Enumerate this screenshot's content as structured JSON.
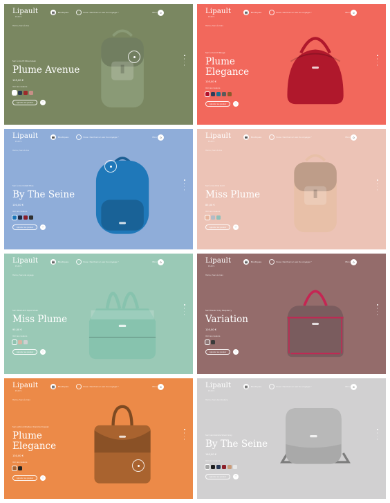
{
  "header": {
    "logo": "Lipault",
    "logo_sub": "PARIS",
    "nav_label": "Boutiques",
    "search_placeholder": "Vous cherchez un sac de voyage ?",
    "account_label": "Mon Sac",
    "cart_count": "0"
  },
  "cards": [
    {
      "bg": "#7a8761",
      "crumb": "Home  /  Sacs à dos",
      "eyebrow": "Sac à dos M Olive Green",
      "name_lines": [
        "Plume Avenue"
      ],
      "price": "105,00 €",
      "colors_label": "Voir les couleurs",
      "swatches": [
        "#ffffff",
        "#2b3b52",
        "#9c2a2b",
        "#c78f86"
      ],
      "cta": "Ajouter au panier",
      "cta_icon": "♡"
    },
    {
      "bg": "#f2685c",
      "crumb": "Home  /  Sacs à main",
      "eyebrow": "Sac à main M Rouge",
      "name_lines": [
        "Plume",
        "Elegance"
      ],
      "price": "105,00 €",
      "colors_label": "Voir les couleurs",
      "swatches": [
        "#b3102b",
        "#2f3d59",
        "#1f6f8f",
        "#5a5a5a",
        "#8b5a2b"
      ],
      "cta": "Ajouter au panier",
      "cta_icon": "♡"
    },
    {
      "bg": "#8fadd9",
      "crumb": "Home  /  Sacs à dos",
      "eyebrow": "Sac à dos Cobalt Blue",
      "name_lines": [
        "By The Seine"
      ],
      "price": "100,00 €",
      "colors_label": "Voir les couleurs",
      "swatches": [
        "#1c74b8",
        "#1f2a44",
        "#8a1e2a",
        "#303030"
      ],
      "cta": "Ajouter au panier",
      "cta_icon": "♡"
    },
    {
      "bg": "#ecc3b6",
      "crumb": "Home  /  Sacs à dos",
      "eyebrow": "Sac à dos Pink Gold",
      "name_lines": [
        "Miss Plume"
      ],
      "price": "85,00 €",
      "colors_label": "Voir les couleurs",
      "swatches": [
        "#e7b59d",
        "#b4bcc6",
        "#8fc0ba"
      ],
      "cta": "Ajouter au panier",
      "cta_icon": "♡"
    },
    {
      "bg": "#9ac9b6",
      "crumb": "Home  /  Sacs de voyage",
      "eyebrow": "Sac Week-end Aqua Green",
      "name_lines": [
        "Miss Plume"
      ],
      "price": "95,00 €",
      "colors_label": "Voir les couleurs",
      "swatches": [
        "#8fc3b0",
        "#d8b4a3",
        "#d0d0d0"
      ],
      "cta": "Ajouter au panier",
      "cta_icon": "♡"
    },
    {
      "bg": "#946c6b",
      "crumb": "Home  /  Sacs à main",
      "eyebrow": "Sac Bowler Grey Raspberry",
      "name_lines": [
        "Variation"
      ],
      "price": "105,00 €",
      "colors_label": "Voir les couleurs",
      "swatches": [
        "#8e7676",
        "#3a3a3a"
      ],
      "cta": "Ajouter au panier",
      "cta_icon": "♡"
    },
    {
      "bg": "#ec8a48",
      "crumb": "Home  /  Sacs à main",
      "eyebrow": "Sac porté ordinateur Caramel Cognac",
      "name_lines": [
        "Plume",
        "Elegance"
      ],
      "price": "130,00 €",
      "colors_label": "Voir les couleurs",
      "swatches": [
        "#a86434",
        "#222222"
      ],
      "cta": "Ajouter au panier",
      "cta_icon": "♡"
    },
    {
      "bg": "#d1d0d1",
      "crumb": "Home  /  Sacs bandoulière",
      "eyebrow": "Sac bandoulière Silver Grey",
      "name_lines": [
        "By The Seine"
      ],
      "price": "160,00 €",
      "colors_label": "Voir les couleurs",
      "swatches": [
        "#a5a5a5",
        "#1e1e1e",
        "#2b3a57",
        "#8d1f2a",
        "#c99b7a",
        "#e8e8e8"
      ],
      "cta": "Ajouter au panier",
      "cta_icon": "♡"
    }
  ],
  "bags": [
    {
      "type": "backpack",
      "color": "#8a9a76",
      "icon": "backpack-icon"
    },
    {
      "type": "dome",
      "color": "#b0182c",
      "icon": "handbag-icon"
    },
    {
      "type": "roundpack",
      "color": "#1f78b9",
      "icon": "backpack-icon"
    },
    {
      "type": "backpack",
      "color": "#e8c0a8",
      "icon": "backpack-icon"
    },
    {
      "type": "duffel",
      "color": "#87c3ae",
      "icon": "duffel-bag-icon"
    },
    {
      "type": "bowler",
      "color": "#7a5c5e",
      "icon": "handbag-icon"
    },
    {
      "type": "satchel",
      "color": "#a9632f",
      "icon": "handbag-icon"
    },
    {
      "type": "crossbody",
      "color": "#a9a9a9",
      "icon": "crossbody-bag-icon"
    }
  ]
}
